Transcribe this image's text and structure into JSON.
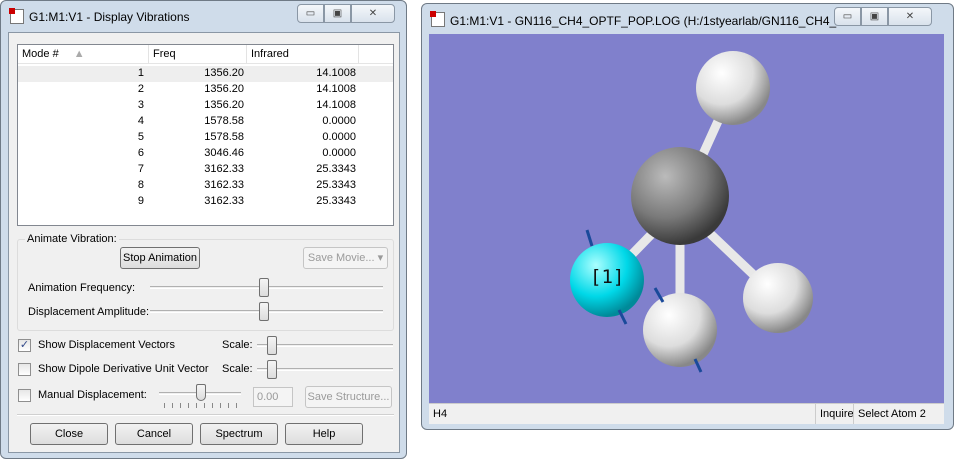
{
  "vib": {
    "title": "G1:M1:V1 - Display Vibrations",
    "columns": [
      "Mode #",
      "Freq",
      "Infrared"
    ],
    "rows": [
      [
        "1",
        "1356.20",
        "14.1008"
      ],
      [
        "2",
        "1356.20",
        "14.1008"
      ],
      [
        "3",
        "1356.20",
        "14.1008"
      ],
      [
        "4",
        "1578.58",
        "0.0000"
      ],
      [
        "5",
        "1578.58",
        "0.0000"
      ],
      [
        "6",
        "3046.46",
        "0.0000"
      ],
      [
        "7",
        "3162.33",
        "25.3343"
      ],
      [
        "8",
        "3162.33",
        "25.3343"
      ],
      [
        "9",
        "3162.33",
        "25.3343"
      ]
    ],
    "selected_row": 1,
    "animate_label": "Animate Vibration:",
    "stop_animation": "Stop Animation",
    "save_movie": "Save Movie...",
    "anim_freq_label": "Animation Frequency:",
    "disp_amp_label": "Displacement Amplitude:",
    "show_disp_vectors": "Show Displacement Vectors",
    "show_disp_checked": true,
    "show_dipole": "Show Dipole Derivative Unit Vector",
    "show_dipole_checked": false,
    "scale_label": "Scale:",
    "manual_disp": "Manual Displacement:",
    "manual_checked": false,
    "manual_value": "0.00",
    "save_structure": "Save Structure...",
    "buttons": {
      "close": "Close",
      "cancel": "Cancel",
      "spectrum": "Spectrum",
      "help": "Help"
    }
  },
  "viewer": {
    "title": "G1:M1:V1 - GN116_CH4_OPTF_POP.LOG (H:/1styearlab/GN116_CH4_O...",
    "background": "#8080cc",
    "atom_label": "[1]",
    "status_left": "H4",
    "status_mode": "Inquire",
    "status_right": "Select Atom 2"
  },
  "window_controls": {
    "minimize": "▭",
    "maximize": "▣",
    "close": "✕"
  }
}
